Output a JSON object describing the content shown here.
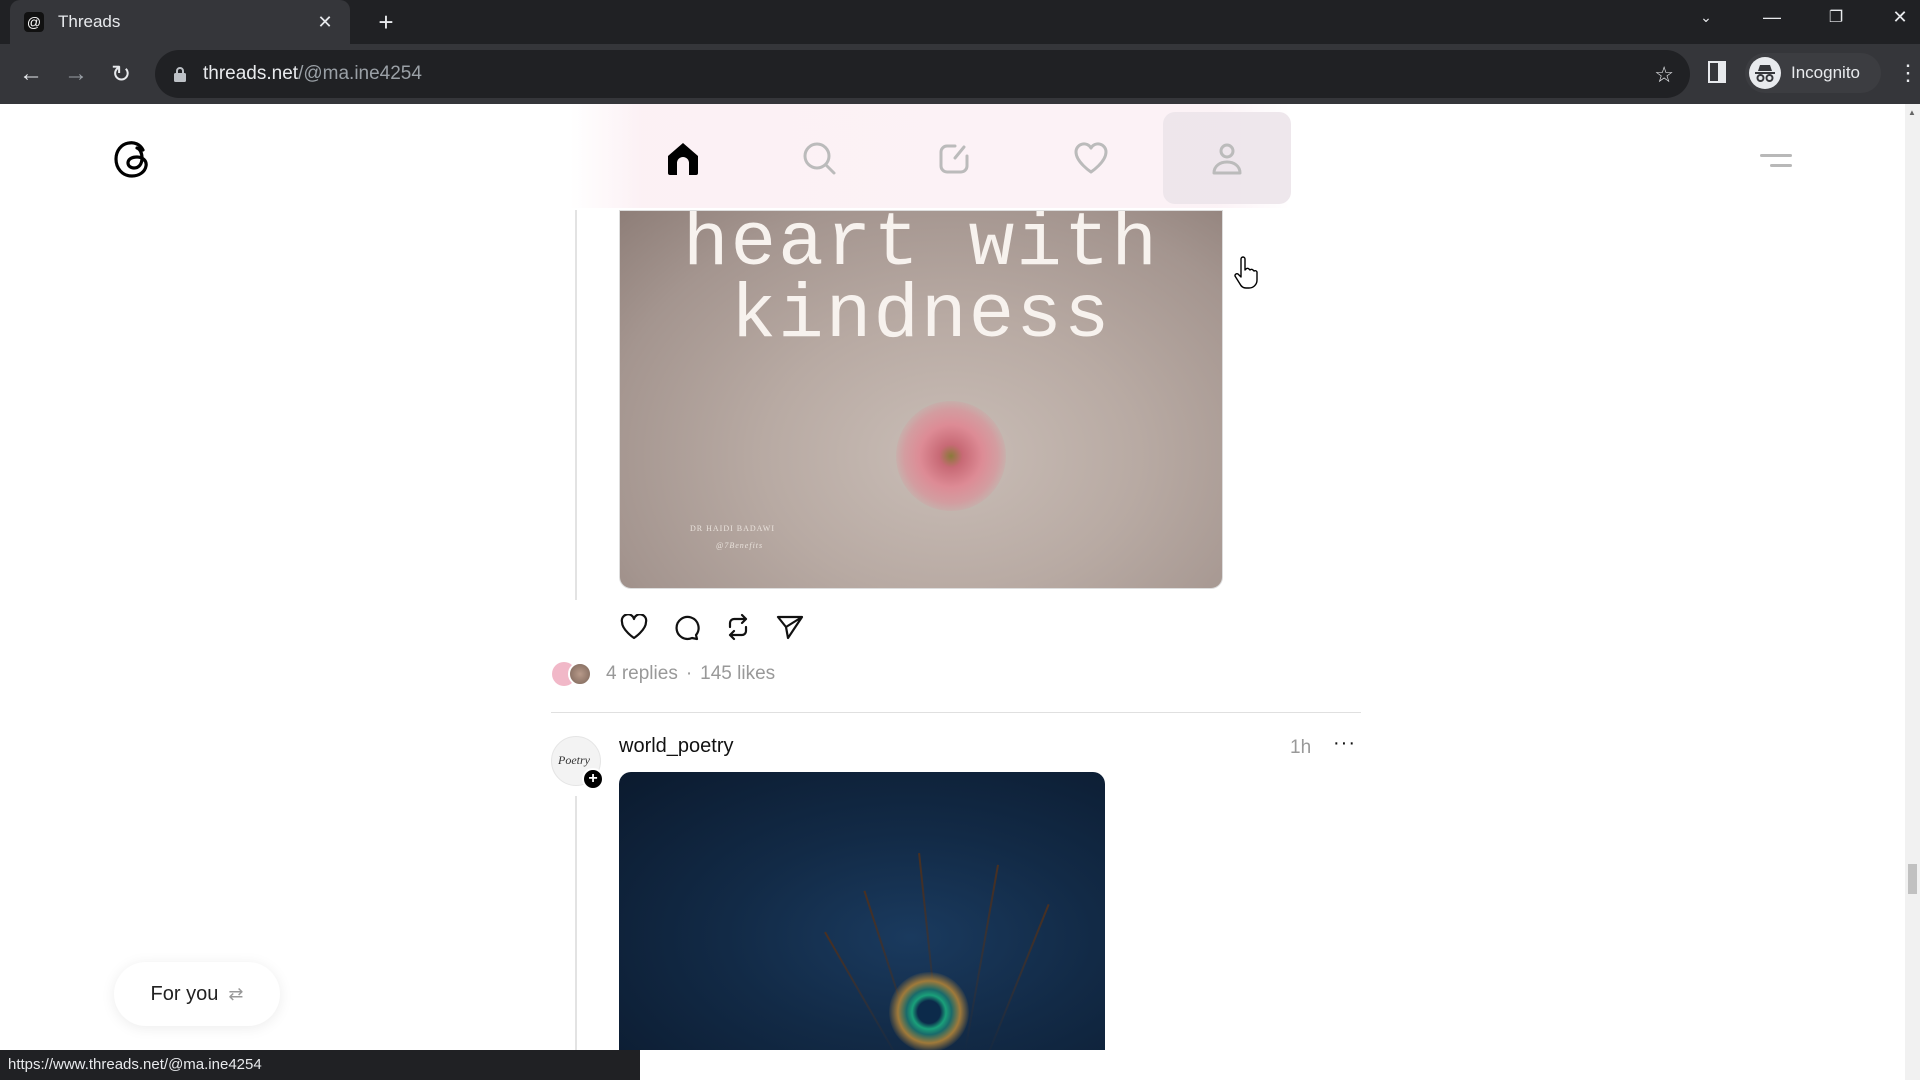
{
  "browser": {
    "tab_title": "Threads",
    "url_host": "threads.net",
    "url_path": "/@ma.ine4254",
    "profile_label": "Incognito",
    "status_url": "https://www.threads.net/@ma.ine4254"
  },
  "nav": {
    "items": [
      {
        "name": "home",
        "active": true
      },
      {
        "name": "search",
        "active": false
      },
      {
        "name": "compose",
        "active": false
      },
      {
        "name": "activity",
        "active": false
      },
      {
        "name": "profile",
        "active": false,
        "hovered": true
      }
    ]
  },
  "posts": [
    {
      "image_text_line1": "heart with",
      "image_text_line2": "kindness",
      "image_credit_name": "DR HAIDI BADAWI",
      "image_credit_handle": "@7Benefits",
      "replies": "4 replies",
      "separator": "·",
      "likes": "145 likes"
    },
    {
      "username": "world_poetry",
      "avatar_text": "Poetry",
      "time": "1h",
      "more_label": "···"
    }
  ],
  "feed_switch": {
    "label": "For you",
    "icon": "⇄"
  }
}
